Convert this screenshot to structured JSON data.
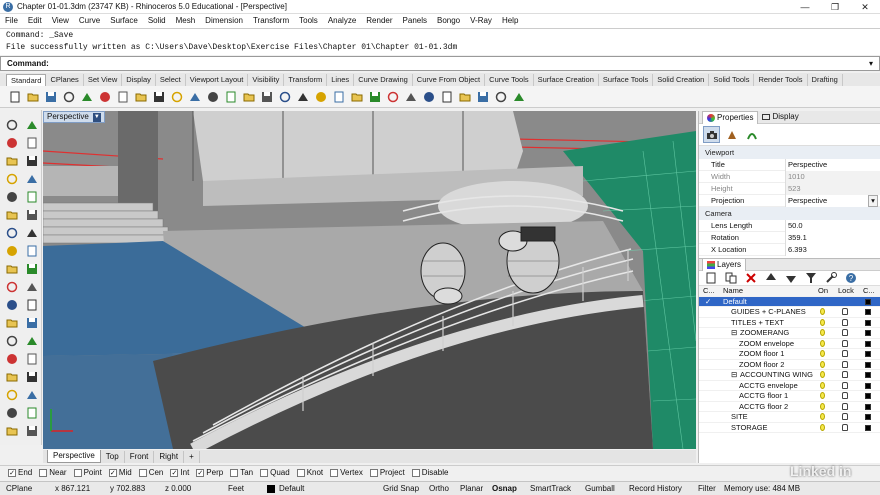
{
  "app": {
    "title": "Chapter 01-01.3dm (23747 KB) - Rhinoceros 5.0 Educational - [Perspective]"
  },
  "window_buttons": [
    "—",
    "❐",
    "✕"
  ],
  "menu": [
    "File",
    "Edit",
    "View",
    "Curve",
    "Surface",
    "Solid",
    "Mesh",
    "Dimension",
    "Transform",
    "Tools",
    "Analyze",
    "Render",
    "Panels",
    "Bongo",
    "V-Ray",
    "Help"
  ],
  "command_history": [
    "Command: _Save",
    "File successfully written as C:\\Users\\Dave\\Desktop\\Exercise Files\\Chapter 01\\Chapter 01-01.3dm"
  ],
  "command_prompt": "Command:",
  "toolbar_tabs": [
    "Standard",
    "CPlanes",
    "Set View",
    "Display",
    "Select",
    "Viewport Layout",
    "Visibility",
    "Transform",
    "Lines",
    "Curve Drawing",
    "Curve From Object",
    "Curve Tools",
    "Surface Creation",
    "Surface Tools",
    "Solid Creation",
    "Solid Tools",
    "Render Tools",
    "Drafting"
  ],
  "toolbar_icons": [
    "new-file-icon",
    "open-file-icon",
    "save-icon",
    "print-icon",
    "import-icon",
    "cut-icon",
    "copy-icon",
    "paste-icon",
    "undo-icon",
    "redo-icon",
    "pan-icon",
    "rotate-view-icon",
    "zoom-dynamic-icon",
    "zoom-window-icon",
    "zoom-extents-icon",
    "zoom-selected-icon",
    "four-views-icon",
    "grid-icon",
    "car-icon",
    "bulb-icon",
    "lightbulb-icon",
    "paint-icon",
    "color-wheel-icon",
    "sphere-shaded-icon",
    "sphere-render-icon",
    "sphere-blue-icon",
    "gear-icon",
    "layer-icon",
    "help-icon"
  ],
  "left_tools": [
    "select-arrow-icon",
    "select-point-icon",
    "polyline-icon",
    "curve-icon",
    "circle-icon",
    "arc-icon",
    "ellipse-icon",
    "rectangle-icon",
    "polygon-icon",
    "freeform-icon",
    "surface-icon",
    "surface-edge-icon",
    "box-icon",
    "cylinder-icon",
    "extrude-icon",
    "mesh-icon",
    "boolean-icon",
    "loft-icon",
    "trim-icon",
    "split-icon",
    "join-icon",
    "explode-icon",
    "fillet-icon",
    "offset-icon",
    "move-icon",
    "copy-tool-icon",
    "rotate-icon",
    "scale-icon",
    "array-icon",
    "mirror-icon",
    "text-icon",
    "dimension-icon",
    "check-icon",
    "analyze-icon",
    "paint-tool-icon",
    "render-tool-icon"
  ],
  "viewport": {
    "label": "Perspective"
  },
  "viewport_tabs": [
    "Perspective",
    "Top",
    "Front",
    "Right",
    "+"
  ],
  "properties": {
    "tabs": [
      "Properties",
      "Display"
    ],
    "section_viewport": "Viewport",
    "rows": [
      {
        "key": "Title",
        "value": "Perspective",
        "dim": false
      },
      {
        "key": "Width",
        "value": "1010",
        "dim": true
      },
      {
        "key": "Height",
        "value": "523",
        "dim": true
      },
      {
        "key": "Projection",
        "value": "Perspective",
        "dim": false
      }
    ],
    "section_camera": "Camera",
    "camera_rows": [
      {
        "key": "Lens Length",
        "value": "50.0"
      },
      {
        "key": "Rotation",
        "value": "359.1"
      },
      {
        "key": "X Location",
        "value": "6.393"
      }
    ]
  },
  "layers": {
    "title": "Layers",
    "headers": {
      "c": "C...",
      "name": "Name",
      "on": "On",
      "lock": "Lock",
      "color": "C..."
    },
    "rows": [
      {
        "name": "Default",
        "indent": 0,
        "selected": true,
        "check": "✓",
        "color": "#000000"
      },
      {
        "name": "GUIDES + C-PLANES",
        "indent": 1,
        "color": "#000000"
      },
      {
        "name": "TITLES + TEXT",
        "indent": 1,
        "color": "#000000"
      },
      {
        "name": "ZOOMERANG",
        "indent": 1,
        "expander": "⊟",
        "color": "#000000"
      },
      {
        "name": "ZOOM envelope",
        "indent": 2,
        "color": "#000000"
      },
      {
        "name": "ZOOM floor 1",
        "indent": 2,
        "color": "#000000"
      },
      {
        "name": "ZOOM floor 2",
        "indent": 2,
        "color": "#000000"
      },
      {
        "name": "ACCOUNTING WING",
        "indent": 1,
        "expander": "⊟",
        "color": "#000000"
      },
      {
        "name": "ACCTG envelope",
        "indent": 2,
        "color": "#000000"
      },
      {
        "name": "ACCTG floor 1",
        "indent": 2,
        "color": "#000000"
      },
      {
        "name": "ACCTG floor 2",
        "indent": 2,
        "color": "#000000"
      },
      {
        "name": "SITE",
        "indent": 1,
        "color": "#000000"
      },
      {
        "name": "STORAGE",
        "indent": 1,
        "color": "#000000"
      }
    ]
  },
  "osnaps": [
    {
      "label": "End",
      "checked": true
    },
    {
      "label": "Near",
      "checked": false
    },
    {
      "label": "Point",
      "checked": false
    },
    {
      "label": "Mid",
      "checked": true
    },
    {
      "label": "Cen",
      "checked": false
    },
    {
      "label": "Int",
      "checked": true
    },
    {
      "label": "Perp",
      "checked": true
    },
    {
      "label": "Tan",
      "checked": false
    },
    {
      "label": "Quad",
      "checked": false
    },
    {
      "label": "Knot",
      "checked": false
    },
    {
      "label": "Vertex",
      "checked": false
    },
    {
      "label": "Project",
      "checked": false
    },
    {
      "label": "Disable",
      "checked": false
    }
  ],
  "status": {
    "cplane": "CPlane",
    "x": "x 867.121",
    "y": "y 702.883",
    "z": "z 0.000",
    "units": "Feet",
    "layer": "Default",
    "buttons": [
      "Grid Snap",
      "Ortho",
      "Planar",
      "Osnap",
      "SmartTrack",
      "Gumball",
      "Record History",
      "Filter"
    ],
    "memory": "Memory use: 484 MB"
  },
  "watermark": "Linked in",
  "colors": {
    "accent": "#2f66c6",
    "water": "#3b6c99",
    "grass": "#1f8a67"
  }
}
